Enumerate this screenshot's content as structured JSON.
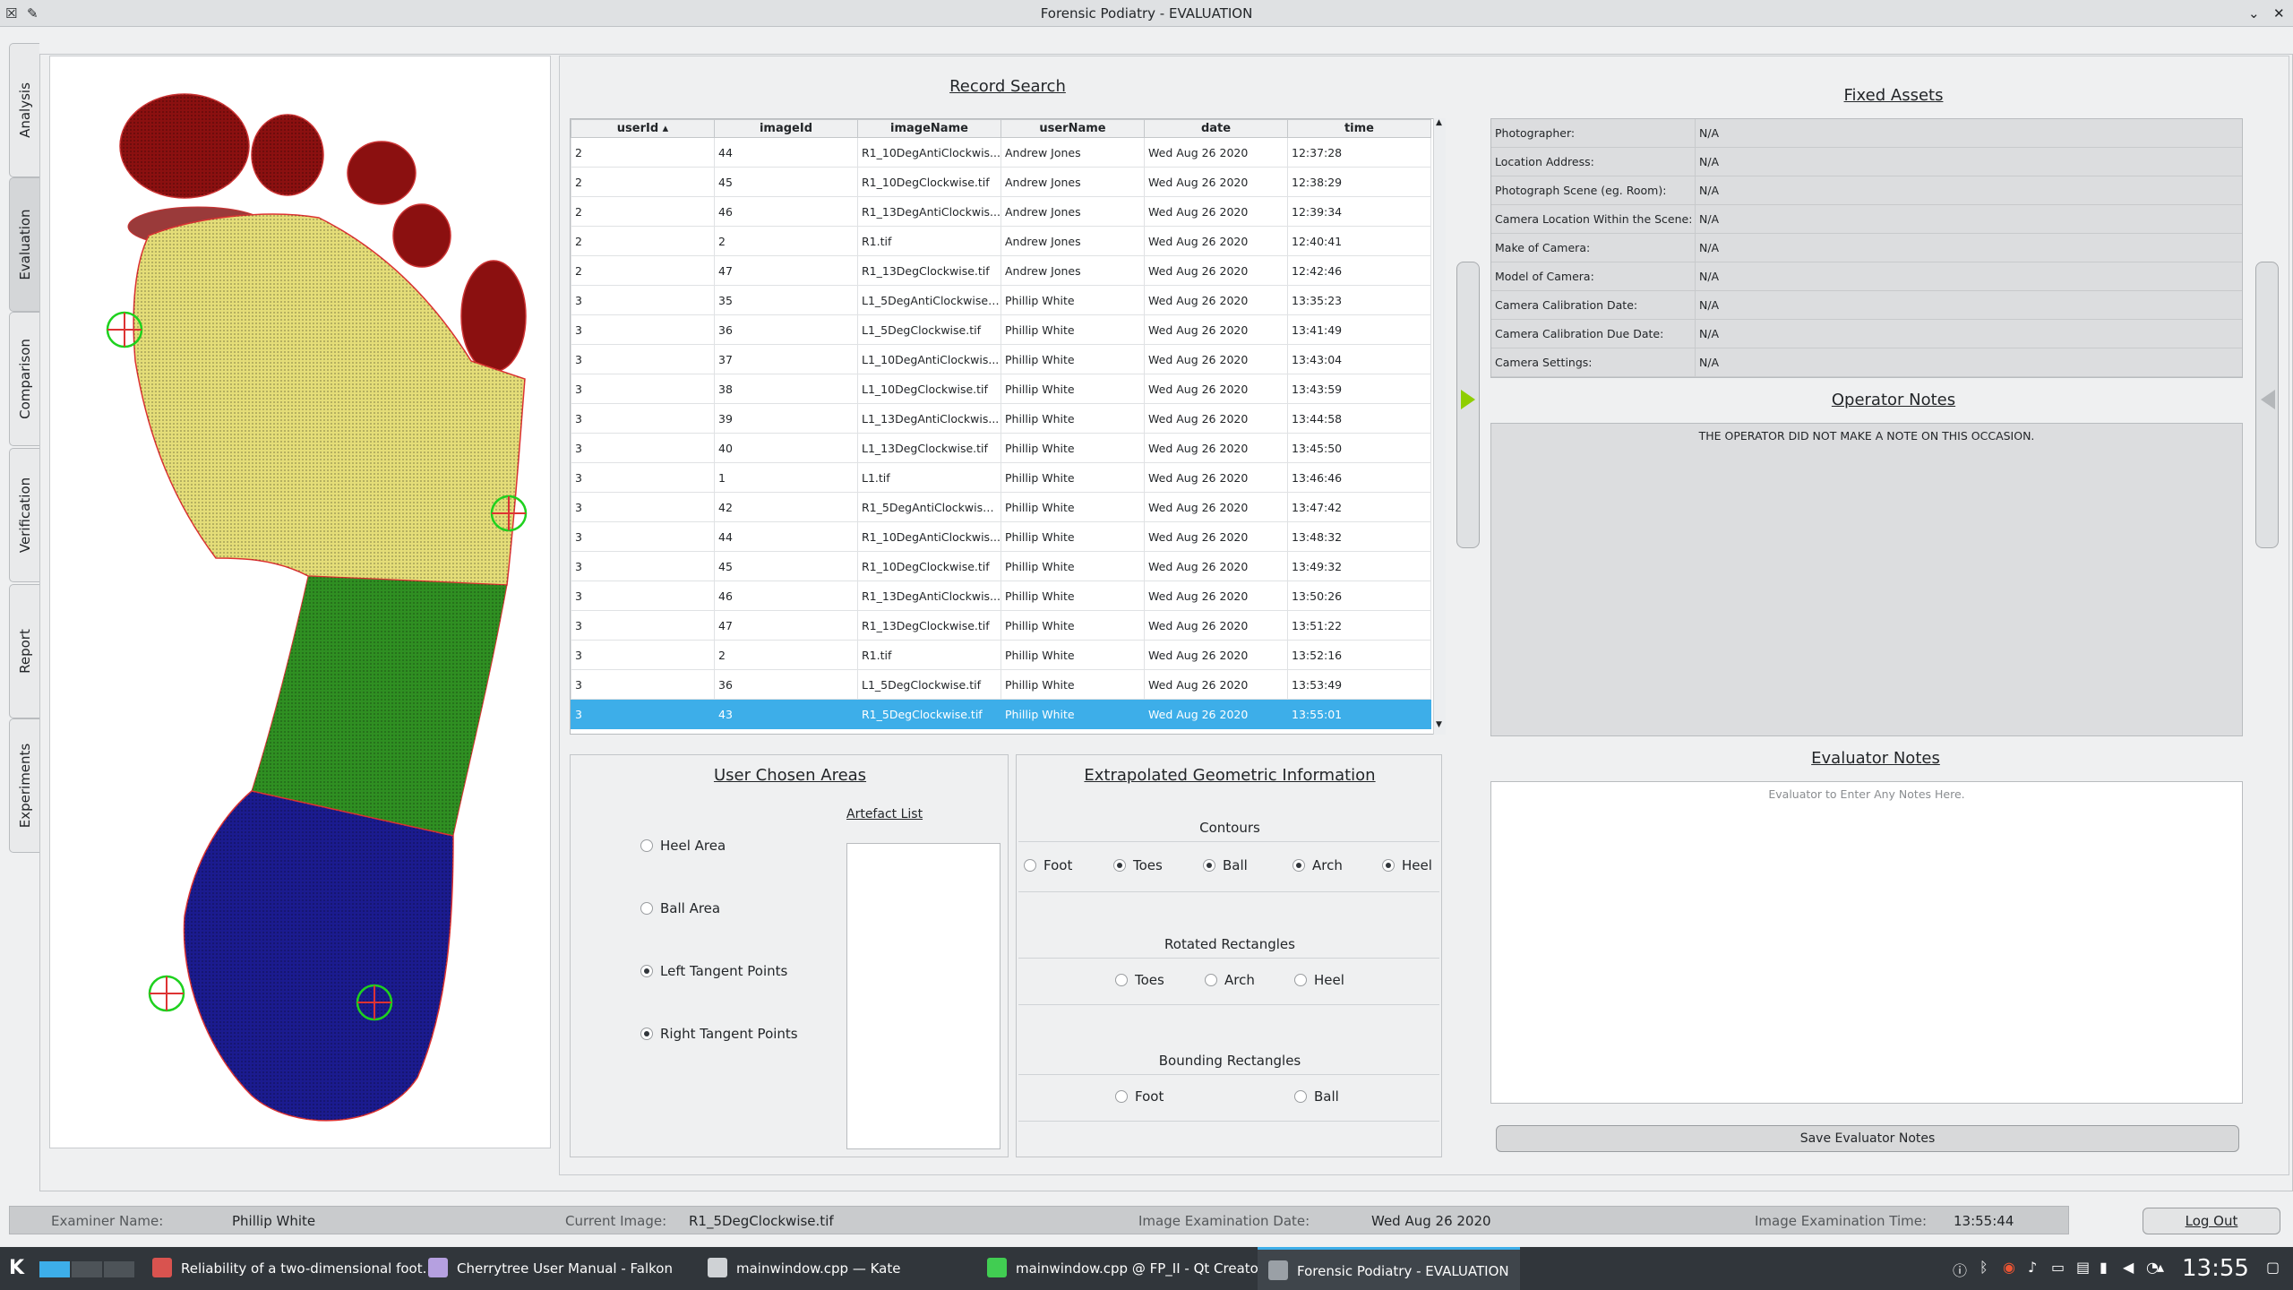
{
  "window": {
    "title": "Forensic Podiatry - EVALUATION"
  },
  "side_tabs": [
    "Analysis",
    "Evaluation",
    "Comparison",
    "Verification",
    "Report",
    "Experiments"
  ],
  "active_tab": "Evaluation",
  "record_search": {
    "title": "Record Search",
    "columns": [
      "userId",
      "imageId",
      "imageName",
      "userName",
      "date",
      "time"
    ],
    "rows": [
      [
        "2",
        "44",
        "R1_10DegAntiClockwis...",
        "Andrew Jones",
        "Wed Aug 26 2020",
        "12:37:28"
      ],
      [
        "2",
        "45",
        "R1_10DegClockwise.tif",
        "Andrew Jones",
        "Wed Aug 26 2020",
        "12:38:29"
      ],
      [
        "2",
        "46",
        "R1_13DegAntiClockwis...",
        "Andrew Jones",
        "Wed Aug 26 2020",
        "12:39:34"
      ],
      [
        "2",
        "2",
        "R1.tif",
        "Andrew Jones",
        "Wed Aug 26 2020",
        "12:40:41"
      ],
      [
        "2",
        "47",
        "R1_13DegClockwise.tif",
        "Andrew Jones",
        "Wed Aug 26 2020",
        "12:42:46"
      ],
      [
        "3",
        "35",
        "L1_5DegAntiClockwise.tif",
        "Phillip White",
        "Wed Aug 26 2020",
        "13:35:23"
      ],
      [
        "3",
        "36",
        "L1_5DegClockwise.tif",
        "Phillip White",
        "Wed Aug 26 2020",
        "13:41:49"
      ],
      [
        "3",
        "37",
        "L1_10DegAntiClockwis...",
        "Phillip White",
        "Wed Aug 26 2020",
        "13:43:04"
      ],
      [
        "3",
        "38",
        "L1_10DegClockwise.tif",
        "Phillip White",
        "Wed Aug 26 2020",
        "13:43:59"
      ],
      [
        "3",
        "39",
        "L1_13DegAntiClockwis...",
        "Phillip White",
        "Wed Aug 26 2020",
        "13:44:58"
      ],
      [
        "3",
        "40",
        "L1_13DegClockwise.tif",
        "Phillip White",
        "Wed Aug 26 2020",
        "13:45:50"
      ],
      [
        "3",
        "1",
        "L1.tif",
        "Phillip White",
        "Wed Aug 26 2020",
        "13:46:46"
      ],
      [
        "3",
        "42",
        "R1_5DegAntiClockwise....",
        "Phillip White",
        "Wed Aug 26 2020",
        "13:47:42"
      ],
      [
        "3",
        "44",
        "R1_10DegAntiClockwis...",
        "Phillip White",
        "Wed Aug 26 2020",
        "13:48:32"
      ],
      [
        "3",
        "45",
        "R1_10DegClockwise.tif",
        "Phillip White",
        "Wed Aug 26 2020",
        "13:49:32"
      ],
      [
        "3",
        "46",
        "R1_13DegAntiClockwis...",
        "Phillip White",
        "Wed Aug 26 2020",
        "13:50:26"
      ],
      [
        "3",
        "47",
        "R1_13DegClockwise.tif",
        "Phillip White",
        "Wed Aug 26 2020",
        "13:51:22"
      ],
      [
        "3",
        "2",
        "R1.tif",
        "Phillip White",
        "Wed Aug 26 2020",
        "13:52:16"
      ],
      [
        "3",
        "36",
        "L1_5DegClockwise.tif",
        "Phillip White",
        "Wed Aug 26 2020",
        "13:53:49"
      ],
      [
        "3",
        "43",
        "R1_5DegClockwise.tif",
        "Phillip White",
        "Wed Aug 26 2020",
        "13:55:01"
      ]
    ],
    "selected_row": 19
  },
  "user_chosen_areas": {
    "title": "User Chosen Areas",
    "options": [
      {
        "label": "Heel Area",
        "checked": false
      },
      {
        "label": "Ball Area",
        "checked": false
      },
      {
        "label": "Left Tangent Points",
        "checked": true
      },
      {
        "label": "Right Tangent Points",
        "checked": true
      }
    ],
    "artefact_list_label": "Artefact List"
  },
  "geometric": {
    "title": "Extrapolated Geometric Information",
    "contours": {
      "label": "Contours",
      "options": [
        {
          "label": "Foot",
          "checked": false
        },
        {
          "label": "Toes",
          "checked": true
        },
        {
          "label": "Ball",
          "checked": true
        },
        {
          "label": "Arch",
          "checked": true
        },
        {
          "label": "Heel",
          "checked": true
        }
      ]
    },
    "rotated": {
      "label": "Rotated Rectangles",
      "options": [
        {
          "label": "Toes",
          "checked": false
        },
        {
          "label": "Arch",
          "checked": false
        },
        {
          "label": "Heel",
          "checked": false
        }
      ]
    },
    "bounding": {
      "label": "Bounding Rectangles",
      "options": [
        {
          "label": "Foot",
          "checked": false
        },
        {
          "label": "Ball",
          "checked": false
        }
      ]
    }
  },
  "fixed_assets": {
    "title": "Fixed Assets",
    "rows": [
      {
        "key": "Photographer:",
        "value": "N/A"
      },
      {
        "key": "Location Address:",
        "value": "N/A"
      },
      {
        "key": "Photograph Scene (eg. Room):",
        "value": "N/A"
      },
      {
        "key": "Camera Location Within the Scene:",
        "value": "N/A"
      },
      {
        "key": "Make of Camera:",
        "value": "N/A"
      },
      {
        "key": "Model of Camera:",
        "value": "N/A"
      },
      {
        "key": "Camera Calibration Date:",
        "value": "N/A"
      },
      {
        "key": "Camera Calibration Due Date:",
        "value": "N/A"
      },
      {
        "key": "Camera Settings:",
        "value": "N/A"
      }
    ]
  },
  "operator_notes": {
    "title": "Operator Notes",
    "text": "THE OPERATOR DID NOT MAKE A NOTE ON THIS OCCASION."
  },
  "evaluator_notes": {
    "title": "Evaluator Notes",
    "placeholder": "Evaluator to Enter Any Notes Here.",
    "save_label": "Save Evaluator Notes"
  },
  "status": {
    "examiner_label": "Examiner Name:",
    "examiner": "Phillip White",
    "image_label": "Current Image:",
    "image": "R1_5DegClockwise.tif",
    "date_label": "Image Examination Date:",
    "date": "Wed Aug 26 2020",
    "time_label": "Image Examination Time:",
    "time": "13:55:44",
    "logout": "Log Out"
  },
  "taskbar": {
    "items": [
      {
        "label": "Reliability of a two-dimensional foot...",
        "icon": "pdf-viewer-icon",
        "color": "#d9534f"
      },
      {
        "label": "Cherrytree User Manual - Falkon",
        "icon": "falkon-icon",
        "color": "#b5a0e0"
      },
      {
        "label": "mainwindow.cpp — Kate",
        "icon": "kate-icon",
        "color": "#cfd2d5"
      },
      {
        "label": "mainwindow.cpp @ FP_II - Qt Creator",
        "icon": "qtcreator-icon",
        "color": "#41cd52"
      },
      {
        "label": "Forensic Podiatry - EVALUATION",
        "icon": "app-icon",
        "color": "#9aa0a6"
      }
    ],
    "clock": "13:55"
  },
  "colors": {
    "selection": "#3daee9",
    "accent_arrow": "#8fce00",
    "toes": "#8b0000",
    "ball": "#e6e07a",
    "arch": "#2e8b1f",
    "heel": "#1a1a8c"
  }
}
